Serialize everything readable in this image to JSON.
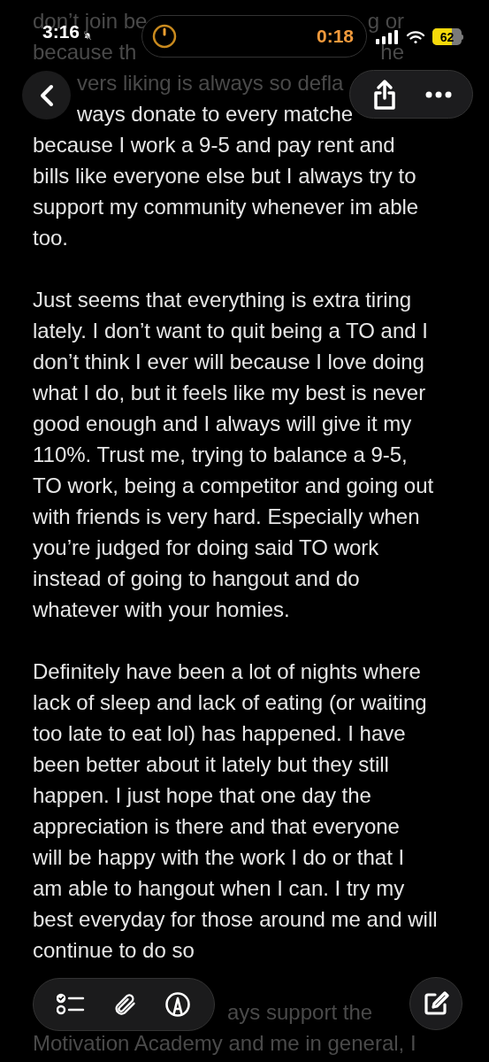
{
  "status_bar": {
    "time": "3:16",
    "timer": "0:18",
    "battery": "62"
  },
  "paragraphs": [
    {
      "lines": [
        {
          "kind": "split",
          "faded": true,
          "segments": [
            "don’t join be",
            "g or"
          ]
        },
        {
          "kind": "split",
          "faded": true,
          "segments": [
            "because th",
            "he"
          ]
        },
        {
          "kind": "after-button",
          "faded": true,
          "segments": [
            "vers liking is always so defla"
          ]
        },
        {
          "kind": "after-button",
          "faded": false,
          "segments": [
            "ways donate to every matche"
          ]
        },
        {
          "kind": "plain",
          "faded": false,
          "segments": [
            "because I work a 9-5 and pay rent and"
          ]
        },
        {
          "kind": "plain",
          "faded": false,
          "segments": [
            "bills like everyone else but I always try to"
          ]
        },
        {
          "kind": "plain",
          "faded": false,
          "segments": [
            "support my community whenever im able"
          ]
        },
        {
          "kind": "plain",
          "faded": false,
          "segments": [
            "too."
          ]
        }
      ]
    },
    {
      "lines": [
        {
          "kind": "plain",
          "faded": false,
          "segments": [
            "Just seems that everything is extra tiring"
          ]
        },
        {
          "kind": "plain",
          "faded": false,
          "segments": [
            "lately. I don’t want to quit being a TO and I"
          ]
        },
        {
          "kind": "plain",
          "faded": false,
          "segments": [
            "don’t think I ever will because I love doing"
          ]
        },
        {
          "kind": "plain",
          "faded": false,
          "segments": [
            "what I do, but it feels like my best is never"
          ]
        },
        {
          "kind": "plain",
          "faded": false,
          "segments": [
            "good enough and I always will give it my"
          ]
        },
        {
          "kind": "plain",
          "faded": false,
          "segments": [
            "110%. Trust me, trying to balance a 9-5,"
          ]
        },
        {
          "kind": "plain",
          "faded": false,
          "segments": [
            "TO work, being a competitor and going out"
          ]
        },
        {
          "kind": "plain",
          "faded": false,
          "segments": [
            "with friends is very hard. Especially when"
          ]
        },
        {
          "kind": "plain",
          "faded": false,
          "segments": [
            "you’re judged for doing said TO work"
          ]
        },
        {
          "kind": "plain",
          "faded": false,
          "segments": [
            "instead of going to hangout and do"
          ]
        },
        {
          "kind": "plain",
          "faded": false,
          "segments": [
            "whatever with your homies."
          ]
        }
      ]
    },
    {
      "lines": [
        {
          "kind": "plain",
          "faded": false,
          "segments": [
            "Definitely have been a lot of nights where"
          ]
        },
        {
          "kind": "plain",
          "faded": false,
          "segments": [
            "lack of sleep and lack of eating (or waiting"
          ]
        },
        {
          "kind": "plain",
          "faded": false,
          "segments": [
            "too late to eat lol) has happened. I have"
          ]
        },
        {
          "kind": "plain",
          "faded": false,
          "segments": [
            "been better about it lately but they still"
          ]
        },
        {
          "kind": "plain",
          "faded": false,
          "segments": [
            "happen. I just hope that one day the"
          ]
        },
        {
          "kind": "plain",
          "faded": false,
          "segments": [
            "appreciation is there and that everyone"
          ]
        },
        {
          "kind": "plain",
          "faded": false,
          "segments": [
            "will be happy with the work I do or that I"
          ]
        },
        {
          "kind": "plain",
          "faded": false,
          "segments": [
            "am able to hangout when I can. I try my"
          ]
        },
        {
          "kind": "plain",
          "faded": false,
          "segments": [
            "best everyday for those around me and will"
          ]
        },
        {
          "kind": "plain",
          "faded": false,
          "segments": [
            "continue to do so"
          ]
        }
      ]
    },
    {
      "lines": [
        {
          "kind": "after-toolbar",
          "faded": true,
          "segments": [
            "ays support the"
          ]
        },
        {
          "kind": "plain",
          "faded": true,
          "segments": [
            "Motivation Academy and me in general, I"
          ]
        }
      ]
    }
  ]
}
